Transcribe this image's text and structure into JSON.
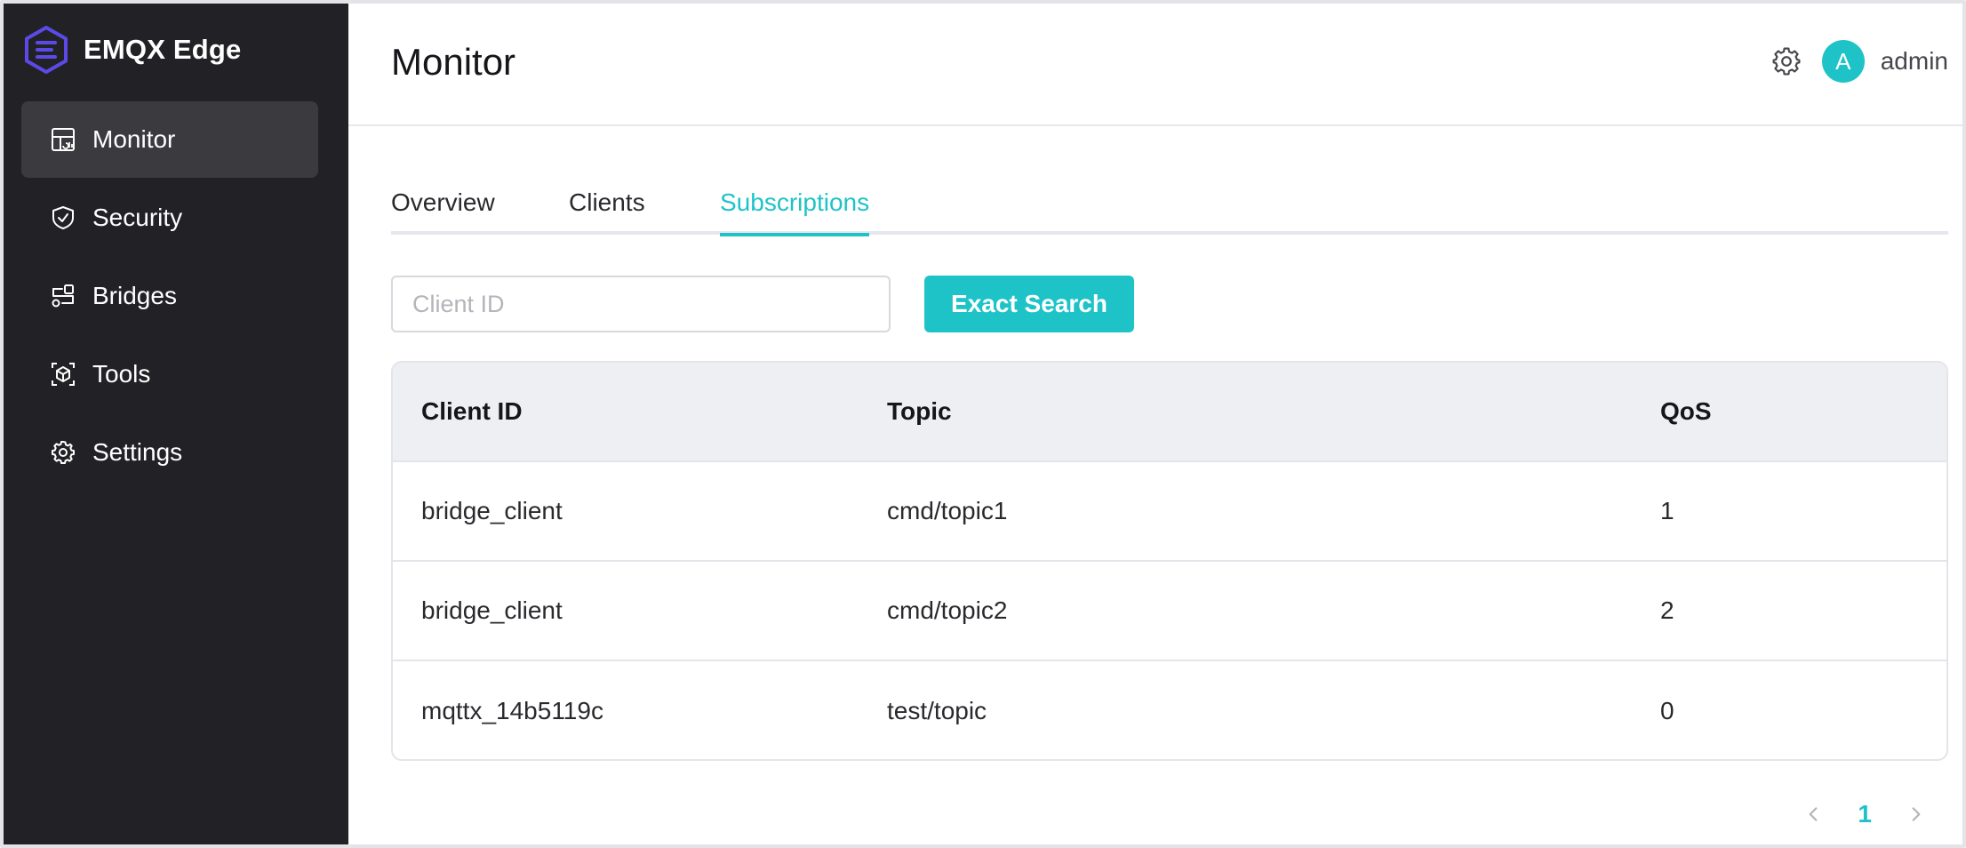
{
  "brand": {
    "name": "EMQX Edge"
  },
  "sidebar": {
    "items": [
      {
        "label": "Monitor",
        "icon": "monitor-icon",
        "active": true
      },
      {
        "label": "Security",
        "icon": "shield-icon",
        "active": false
      },
      {
        "label": "Bridges",
        "icon": "bridge-icon",
        "active": false
      },
      {
        "label": "Tools",
        "icon": "tools-icon",
        "active": false
      },
      {
        "label": "Settings",
        "icon": "gear-icon",
        "active": false
      }
    ]
  },
  "header": {
    "title": "Monitor",
    "avatar_initial": "A",
    "username": "admin"
  },
  "tabs": [
    {
      "label": "Overview",
      "active": false
    },
    {
      "label": "Clients",
      "active": false
    },
    {
      "label": "Subscriptions",
      "active": true
    }
  ],
  "search": {
    "placeholder": "Client ID",
    "value": "",
    "button_label": "Exact Search"
  },
  "table": {
    "columns": [
      "Client ID",
      "Topic",
      "QoS"
    ],
    "rows": [
      [
        "bridge_client",
        "cmd/topic1",
        "1"
      ],
      [
        "bridge_client",
        "cmd/topic2",
        "2"
      ],
      [
        "mqttx_14b5119c",
        "test/topic",
        "0"
      ]
    ]
  },
  "pagination": {
    "current": "1"
  },
  "colors": {
    "accent": "#1ec3c8",
    "sidebar_bg": "#222226",
    "sidebar_active": "#3a3a3f",
    "logo": "#5b4ae8"
  }
}
